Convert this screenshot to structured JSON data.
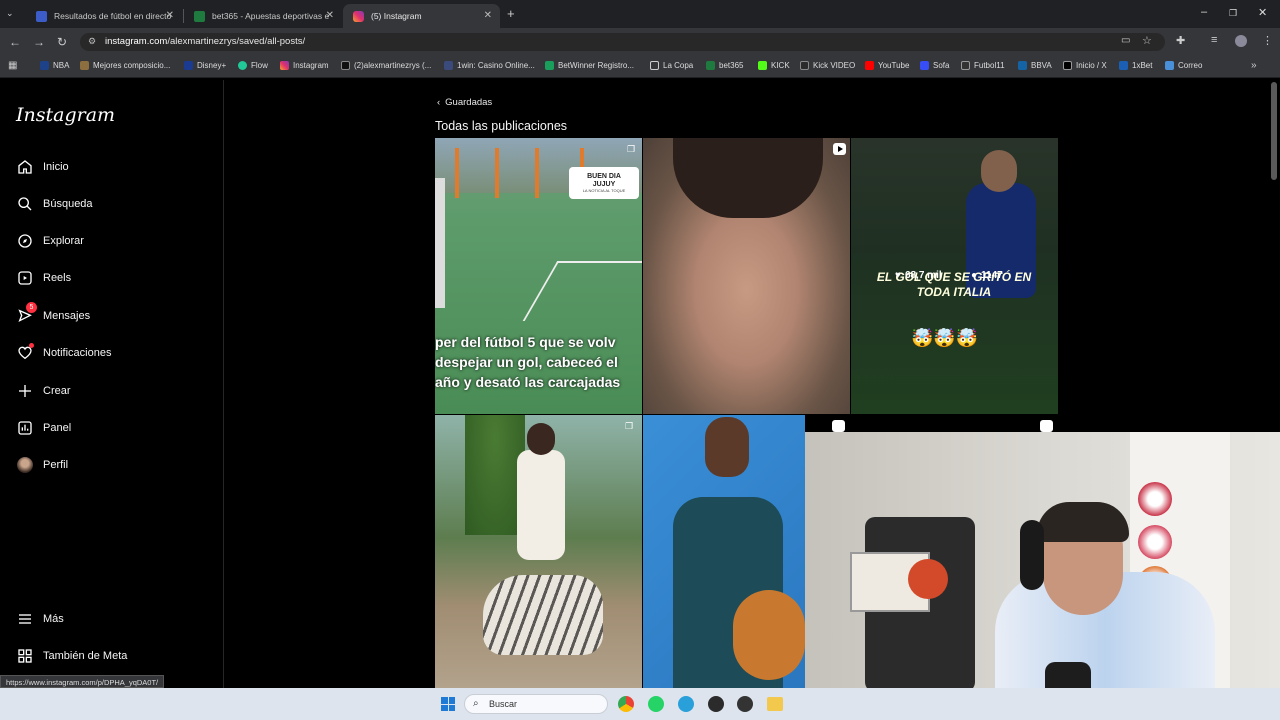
{
  "browser": {
    "tabs": [
      {
        "title": "Resultados de fútbol en directo"
      },
      {
        "title": "bet365 - Apuestas deportivas e"
      },
      {
        "title": "(5) Instagram"
      }
    ],
    "url_host": "instagram.com",
    "url_path": "/alexmartinezrys/saved/all-posts/",
    "bookmarks": [
      "NBA",
      "Mejores composicio...",
      "Disney+",
      "Flow",
      "Instagram",
      "(2)alexmartinezrys (...",
      "1win: Casino Online...",
      "BetWinner Registro...",
      "La Copa",
      "bet365",
      "KICK",
      "Kick VIDEO",
      "YouTube",
      "Sofa",
      "Futbol11",
      "BBVA",
      "Inicio / X",
      "1xBet",
      "Correo"
    ],
    "status_url": "https://www.instagram.com/p/DPHA_yqDA0T/"
  },
  "sidebar": {
    "logo": "Instagram",
    "items": [
      {
        "label": "Inicio",
        "icon": "home-icon"
      },
      {
        "label": "Búsqueda",
        "icon": "search-icon"
      },
      {
        "label": "Explorar",
        "icon": "compass-icon"
      },
      {
        "label": "Reels",
        "icon": "reels-icon"
      },
      {
        "label": "Mensajes",
        "icon": "messenger-icon",
        "badge": "5"
      },
      {
        "label": "Notificaciones",
        "icon": "heart-icon"
      },
      {
        "label": "Crear",
        "icon": "plus-icon"
      },
      {
        "label": "Panel",
        "icon": "chart-icon"
      },
      {
        "label": "Perfil",
        "icon": "avatar-icon"
      }
    ],
    "bottom": [
      {
        "label": "Más",
        "icon": "menu-icon"
      },
      {
        "label": "También de Meta",
        "icon": "meta-icon"
      }
    ]
  },
  "main": {
    "back_label": "Guardadas",
    "title": "Todas las publicaciones",
    "tiles": [
      {
        "badge": "BUEN DIA JUJUY",
        "badge_sub": "LA NOTICIA AL TOQUE",
        "caption": [
          "per del fútbol 5 que se volv",
          "despejar un gol, cabeceó el",
          "año y desató las carcajadas"
        ]
      },
      {
        "caption": []
      },
      {
        "overlay_text": "EL GOL QUE SE GRITÓ EN TODA ITALIA",
        "likes": "68,7 mil",
        "comments": "1147"
      },
      {
        "caption": []
      },
      {
        "caption": []
      },
      {
        "caption": []
      }
    ]
  },
  "taskbar": {
    "search_placeholder": "Buscar"
  },
  "colors": {
    "tab_bg": "#202124",
    "toolbar": "#35363a",
    "ig_bg": "#000000",
    "badge_red": "#ff3040"
  }
}
